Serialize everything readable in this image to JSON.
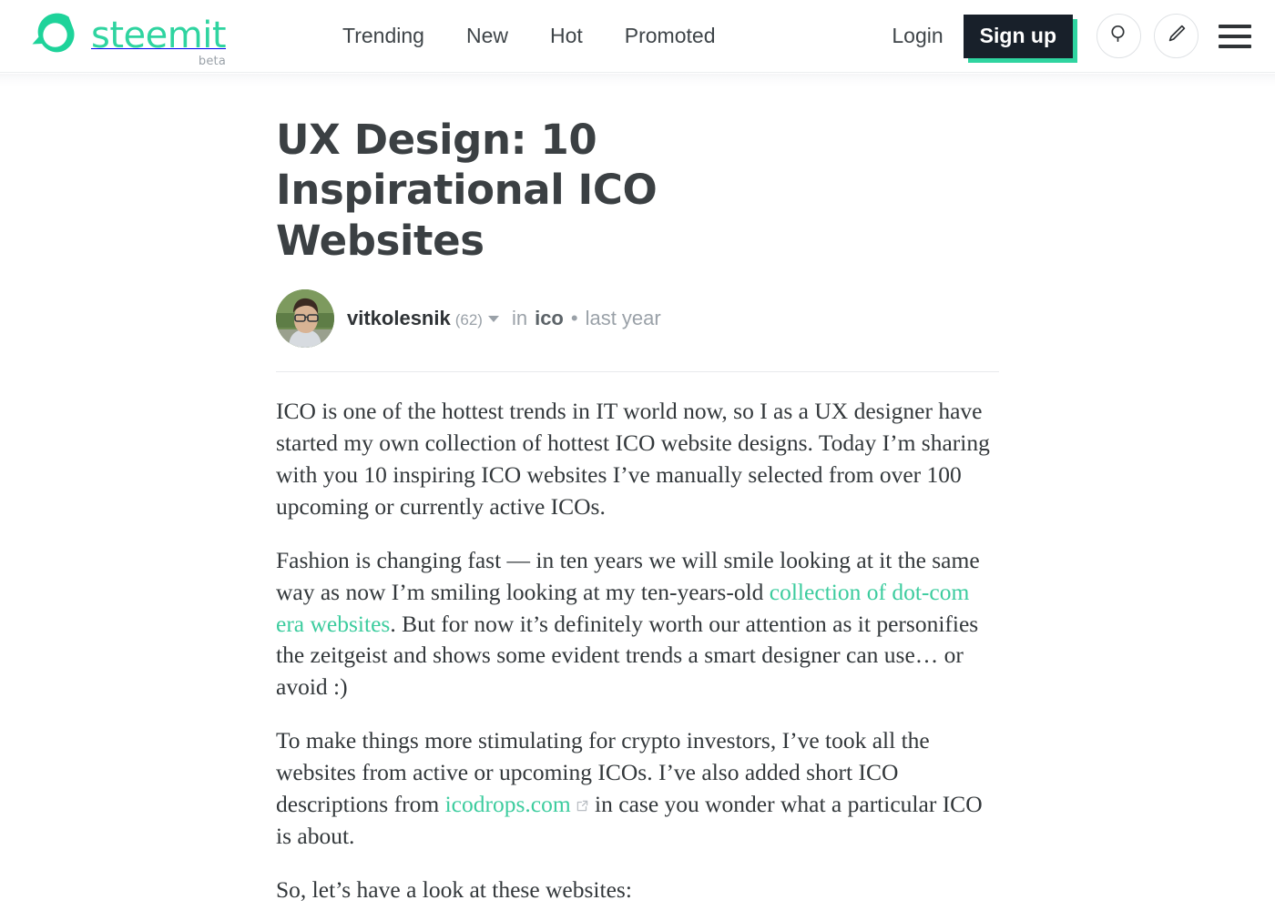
{
  "header": {
    "logo": {
      "word": "steemit",
      "beta": "beta",
      "mark_icon": "steemit-speech-bubble-logo",
      "color": "#2fd4a0"
    },
    "nav": [
      {
        "label": "Trending",
        "name": "nav-trending"
      },
      {
        "label": "New",
        "name": "nav-new"
      },
      {
        "label": "Hot",
        "name": "nav-hot"
      },
      {
        "label": "Promoted",
        "name": "nav-promoted"
      }
    ],
    "login_label": "Login",
    "signup_label": "Sign up",
    "signup_bg": "#18202a",
    "signup_shadow": "#2fd4a0",
    "search_icon": "search-icon",
    "compose_icon": "pencil-icon",
    "menu_icon": "hamburger-icon"
  },
  "post": {
    "title": "UX Design: 10 Inspirational ICO Websites",
    "author": {
      "name": "vitkolesnik",
      "reputation": "(62)",
      "avatar_icon": "user-avatar-photo"
    },
    "in_label": "in",
    "category": "ico",
    "separator": "•",
    "timestamp": "last year",
    "paragraphs": {
      "p1": "ICO is one of the hottest trends in IT world now, so I as a UX designer have started my own collection of hottest ICO website designs. Today I’m sharing with you 10 inspiring ICO websites I’ve manually selected from over 100 upcoming or currently active ICOs.",
      "p2_before": "Fashion is changing fast — in ten years we will smile looking at it the same way as now I’m smiling looking at my ten-years-old ",
      "p2_link": "collection of dot-com era websites",
      "p2_after": ". But for now it’s definitely worth our attention as it personifies the zeitgeist and shows some evident trends a smart designer can use… or avoid :)",
      "p3_before": "To make things more stimulating for crypto investors, I’ve took all the websites from active or upcoming ICOs. I’ve also added short ICO descriptions from ",
      "p3_link": "icodrops.com",
      "p3_after": " in case you wonder what a particular ICO is about.",
      "p4": "So, let’s have a look at these websites:"
    },
    "link_color": "#3ccc9e",
    "external_link_icon": "external-link-icon"
  }
}
